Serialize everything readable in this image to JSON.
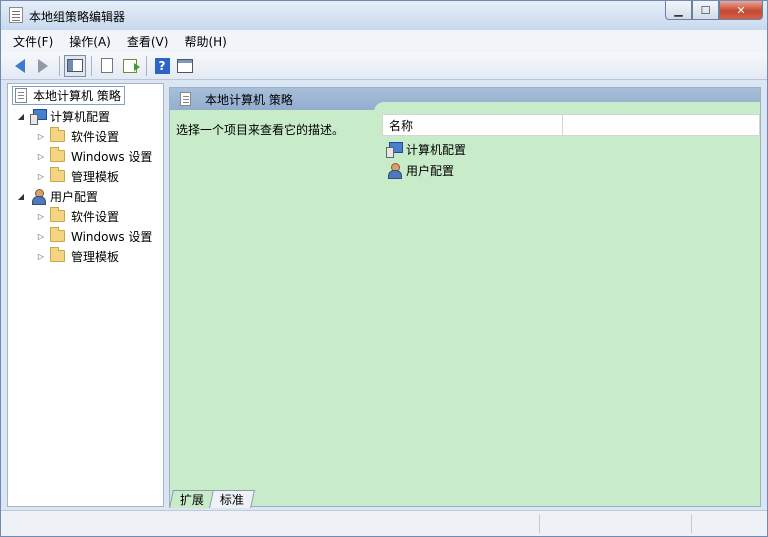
{
  "window": {
    "title": "本地组策略编辑器",
    "controls": {
      "minimize": "▁",
      "maximize": "☐",
      "close": "✕"
    }
  },
  "menubar": {
    "items": [
      {
        "label": "文件(F)"
      },
      {
        "label": "操作(A)"
      },
      {
        "label": "查看(V)"
      },
      {
        "label": "帮助(H)"
      }
    ]
  },
  "toolbar": {
    "buttons": [
      "back-icon",
      "forward-icon",
      "show-hide-tree-icon",
      "properties-icon",
      "export-list-icon",
      "help-icon",
      "action-pane-icon"
    ],
    "help_glyph": "?"
  },
  "tree": {
    "root": {
      "label": "本地计算机 策略"
    },
    "computer_config": {
      "label": "计算机配置",
      "toggle": "◢",
      "children": [
        {
          "label": "软件设置",
          "toggle": "▷"
        },
        {
          "label": "Windows 设置",
          "toggle": "▷"
        },
        {
          "label": "管理模板",
          "toggle": "▷"
        }
      ]
    },
    "user_config": {
      "label": "用户配置",
      "toggle": "◢",
      "children": [
        {
          "label": "软件设置",
          "toggle": "▷"
        },
        {
          "label": "Windows 设置",
          "toggle": "▷"
        },
        {
          "label": "管理模板",
          "toggle": "▷"
        }
      ]
    }
  },
  "details": {
    "header_title": "本地计算机 策略",
    "description": "选择一个项目来查看它的描述。",
    "column_name": "名称",
    "items": [
      {
        "label": "计算机配置"
      },
      {
        "label": "用户配置"
      }
    ]
  },
  "tabs": [
    {
      "label": "扩展"
    },
    {
      "label": "标准"
    }
  ],
  "colors": {
    "details_background": "#c8ecc9",
    "header_band": "#a9bfd9",
    "accent_blue": "#3d7cc9"
  }
}
